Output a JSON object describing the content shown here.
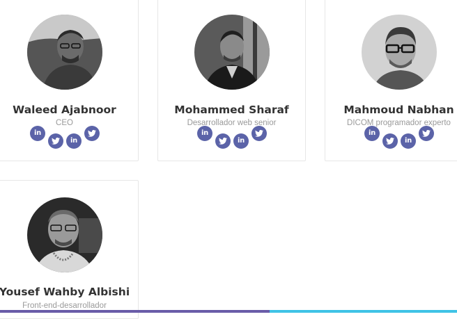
{
  "team": {
    "members": [
      {
        "name": "Waleed Ajabnoor",
        "role": "CEO",
        "social": [
          "linkedin-icon",
          "twitter-icon",
          "linkedin-icon",
          "twitter-icon"
        ]
      },
      {
        "name": "Mohammed Sharaf",
        "role": "Desarrollador web senior",
        "social": [
          "linkedin-icon",
          "twitter-icon",
          "linkedin-icon",
          "twitter-icon"
        ]
      },
      {
        "name": "Mahmoud Nabhan",
        "role": "DICOM programador experto",
        "social": [
          "linkedin-icon",
          "twitter-icon",
          "linkedin-icon",
          "twitter-icon"
        ]
      },
      {
        "name": "Yousef Wahby Albishi",
        "role": "Front-end-desarrollador",
        "social": []
      }
    ],
    "linkedin_label": "in"
  },
  "scroll_progress": {
    "value_percent": 59
  },
  "colors": {
    "social_bg": "#5b63a8",
    "progress_fill": "#6a5ca8",
    "progress_track": "#3fc3e6"
  }
}
